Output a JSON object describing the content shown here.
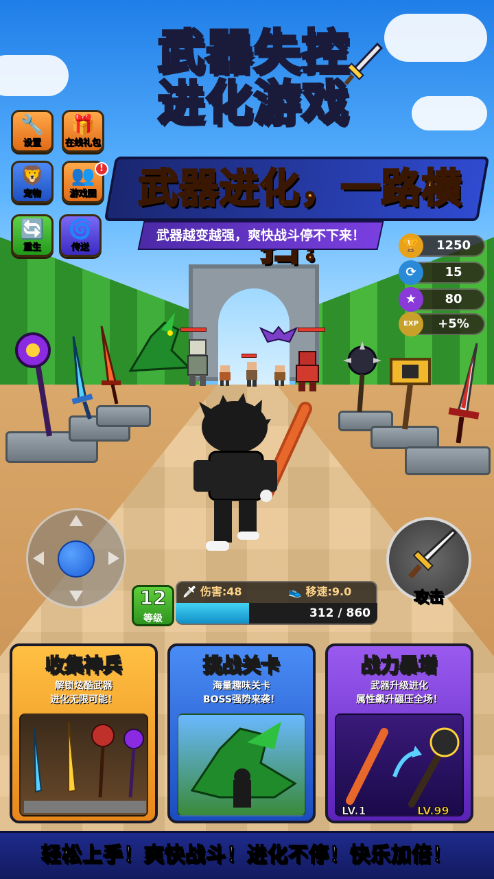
{
  "title": {
    "line1": "武器失控",
    "line2": "进化游戏"
  },
  "banner": {
    "headline": "武器进化，一路横扫！",
    "subline": "武器越变越强，爽快战斗停不下来！"
  },
  "menu": {
    "settings": "设置",
    "online_gift": "在线礼包",
    "pet": "宠物",
    "game_circle": "游戏圈",
    "game_circle_badge": "!",
    "rebirth": "重生",
    "teleport": "传送"
  },
  "stats": {
    "trophy": "1250",
    "refresh": "15",
    "gem": "80",
    "exp": "+5%",
    "exp_icon_text": "EXP"
  },
  "hud": {
    "level": "12",
    "level_label": "等级",
    "damage_label": "伤害:48",
    "speed_label": "移速:9.0",
    "xp_text": "312 / 860",
    "xp_current": 312,
    "xp_max": 860,
    "attack_label": "攻击"
  },
  "cards": [
    {
      "title": "收集神兵",
      "desc1": "解锁炫酷武器",
      "desc2": "进化无限可能！"
    },
    {
      "title": "挑战关卡",
      "desc1": "海量趣味关卡",
      "desc2": "BOSS强势来袭！"
    },
    {
      "title": "战力暴增",
      "desc1": "武器升级进化",
      "desc2": "属性飙升碾压全场！",
      "lv_from": "LV.1",
      "lv_to": "LV.99"
    }
  ],
  "footer": "轻松上手！爽快战斗！进化不停！快乐加倍！",
  "colors": {
    "card1": "#f2a329",
    "card2": "#2f6fe0",
    "card3": "#7a3fd8",
    "accent_gold": "#ffd23a",
    "xp_fill": "#29b5e8"
  },
  "icons": {
    "settings": "wrench-gear-icon",
    "gift": "gift-box-icon",
    "pet": "lion-icon",
    "game_circle": "people-icon",
    "rebirth": "refresh-arrows-icon",
    "teleport": "portal-icon",
    "trophy": "trophy-icon",
    "gem": "star-gem-icon",
    "attack": "sword-icon"
  }
}
